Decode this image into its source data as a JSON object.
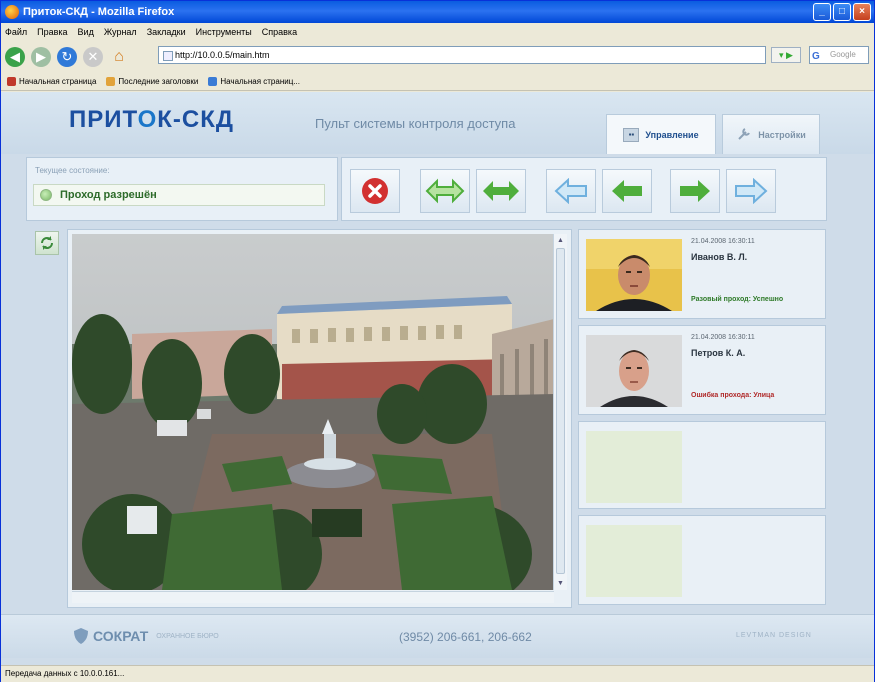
{
  "browser": {
    "title": "Приток-СКД - Mozilla Firefox",
    "menu": [
      "Файл",
      "Правка",
      "Вид",
      "Журнал",
      "Закладки",
      "Инструменты",
      "Справка"
    ],
    "url": "http://10.0.0.5/main.htm",
    "search_placeholder": "Google",
    "bookmarks": [
      "Начальная страница",
      "Последние заголовки",
      "Начальная страниц..."
    ],
    "status": "Передача данных с 10.0.0.161..."
  },
  "app": {
    "logo_part1": "ПРИТ",
    "logo_o": "О",
    "logo_part2": "К-СКД",
    "tagline": "Пульт системы контроля доступа",
    "tabs": [
      {
        "label": "Управление",
        "active": true
      },
      {
        "label": "Настройки",
        "active": false
      }
    ],
    "state_label": "Текущее состояние:",
    "state_value": "Проход разрешён"
  },
  "controls": [
    {
      "name": "deny-button",
      "icon": "close-icon",
      "color": "#d23030"
    },
    {
      "name": "pass-both-once-button",
      "icon": "double-arrow-outline-icon",
      "color": "#7ac25a"
    },
    {
      "name": "pass-both-button",
      "icon": "double-arrow-icon",
      "color": "#4fae3c"
    },
    {
      "name": "pass-left-once-button",
      "icon": "left-arrow-outline-icon",
      "color": "#8fc3e8"
    },
    {
      "name": "pass-left-button",
      "icon": "left-arrow-icon",
      "color": "#4fae3c"
    },
    {
      "name": "pass-right-button",
      "icon": "right-arrow-icon",
      "color": "#4fae3c"
    },
    {
      "name": "pass-right-once-button",
      "icon": "right-arrow-outline-icon",
      "color": "#8fc3e8"
    }
  ],
  "events": [
    {
      "time": "21.04.2008 16:30:11",
      "name": "Иванов В. Л.",
      "status": "Разовый проход: Успешно",
      "kind": "ok"
    },
    {
      "time": "21.04.2008 16:30:11",
      "name": "Петров К. А.",
      "status": "Ошибка прохода: Улица",
      "kind": "err"
    }
  ],
  "footer": {
    "brand": "СОКРАТ",
    "brand_sub": "ОХРАННОЕ БЮРО",
    "phone": "(3952) 206-661, 206-662",
    "design": "LEVTMAN DESIGN"
  }
}
